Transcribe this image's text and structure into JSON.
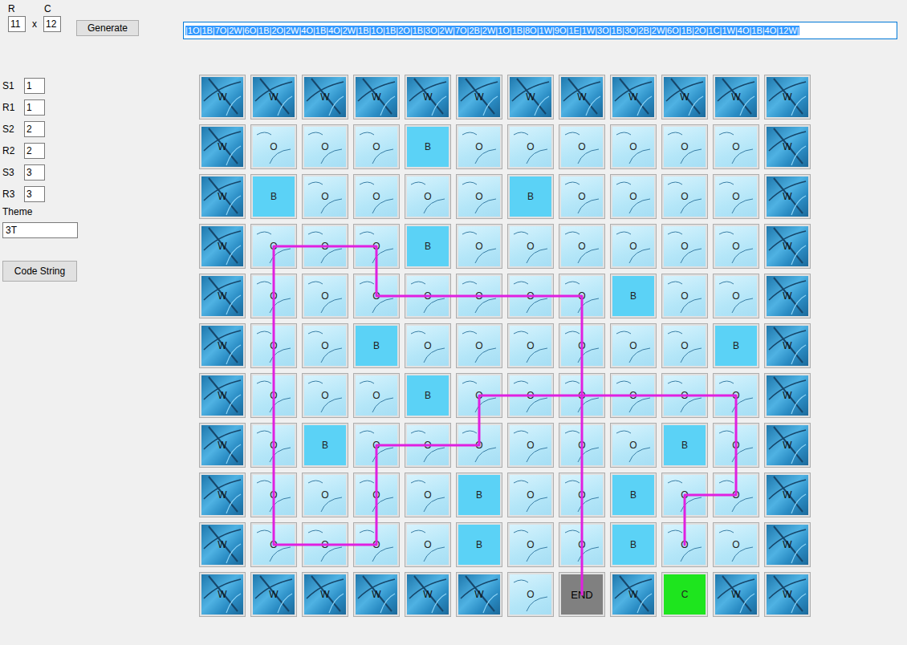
{
  "size": {
    "rows_label": "R",
    "cols_label": "C",
    "rows": "11",
    "times": "x",
    "cols": "12"
  },
  "generate_button": "Generate",
  "code_field": {
    "value": "|1O|1B|7O|2W|6O|1B|2O|2W|4O|1B|4O|2W|1B|1O|1B|2O|1B|3O|2W|7O|2B|2W|1O|1B|8O|1W|9O|1E|1W|3O|1B|3O|2B|2W|6O|1B|2O|1C|1W|4O|1B|4O|12W|",
    "selected": true
  },
  "params": [
    {
      "label": "S1",
      "value": "1"
    },
    {
      "label": "R1",
      "value": "1"
    },
    {
      "label": "S2",
      "value": "2"
    },
    {
      "label": "R2",
      "value": "2"
    },
    {
      "label": "S3",
      "value": "3"
    },
    {
      "label": "R3",
      "value": "3"
    }
  ],
  "theme": {
    "label": "Theme",
    "value": "3T"
  },
  "code_button": "Code String",
  "grid": {
    "rows": [
      [
        {
          "kind": "wall",
          "label": "W"
        },
        {
          "kind": "wall",
          "label": "W"
        },
        {
          "kind": "wall",
          "label": "W"
        },
        {
          "kind": "wall",
          "label": "W"
        },
        {
          "kind": "wall",
          "label": "W"
        },
        {
          "kind": "wall",
          "label": "W"
        },
        {
          "kind": "wall",
          "label": "W"
        },
        {
          "kind": "wall",
          "label": "W"
        },
        {
          "kind": "wall",
          "label": "W"
        },
        {
          "kind": "wall",
          "label": "W"
        },
        {
          "kind": "wall",
          "label": "W"
        },
        {
          "kind": "wall",
          "label": "W"
        }
      ],
      [
        {
          "kind": "wall",
          "label": "W"
        },
        {
          "kind": "open",
          "label": "O"
        },
        {
          "kind": "open",
          "label": "O"
        },
        {
          "kind": "open",
          "label": "O"
        },
        {
          "kind": "block",
          "label": "B"
        },
        {
          "kind": "open",
          "label": "O"
        },
        {
          "kind": "open",
          "label": "O"
        },
        {
          "kind": "open",
          "label": "O"
        },
        {
          "kind": "open",
          "label": "O"
        },
        {
          "kind": "open",
          "label": "O"
        },
        {
          "kind": "open",
          "label": "O"
        },
        {
          "kind": "wall",
          "label": "W"
        }
      ],
      [
        {
          "kind": "wall",
          "label": "W"
        },
        {
          "kind": "block",
          "label": "B"
        },
        {
          "kind": "open",
          "label": "O"
        },
        {
          "kind": "open",
          "label": "O"
        },
        {
          "kind": "open",
          "label": "O"
        },
        {
          "kind": "open",
          "label": "O"
        },
        {
          "kind": "block",
          "label": "B"
        },
        {
          "kind": "open",
          "label": "O"
        },
        {
          "kind": "open",
          "label": "O"
        },
        {
          "kind": "open",
          "label": "O"
        },
        {
          "kind": "open",
          "label": "O"
        },
        {
          "kind": "wall",
          "label": "W"
        }
      ],
      [
        {
          "kind": "wall",
          "label": "W"
        },
        {
          "kind": "open",
          "label": "O"
        },
        {
          "kind": "open",
          "label": "O"
        },
        {
          "kind": "open",
          "label": "O"
        },
        {
          "kind": "block",
          "label": "B"
        },
        {
          "kind": "open",
          "label": "O"
        },
        {
          "kind": "open",
          "label": "O"
        },
        {
          "kind": "open",
          "label": "O"
        },
        {
          "kind": "open",
          "label": "O"
        },
        {
          "kind": "open",
          "label": "O"
        },
        {
          "kind": "open",
          "label": "O"
        },
        {
          "kind": "wall",
          "label": "W"
        }
      ],
      [
        {
          "kind": "wall",
          "label": "W"
        },
        {
          "kind": "open",
          "label": "O"
        },
        {
          "kind": "open",
          "label": "O"
        },
        {
          "kind": "open",
          "label": "O"
        },
        {
          "kind": "open",
          "label": "O"
        },
        {
          "kind": "open",
          "label": "O"
        },
        {
          "kind": "open",
          "label": "O"
        },
        {
          "kind": "open",
          "label": "O"
        },
        {
          "kind": "block",
          "label": "B"
        },
        {
          "kind": "open",
          "label": "O"
        },
        {
          "kind": "open",
          "label": "O"
        },
        {
          "kind": "wall",
          "label": "W"
        }
      ],
      [
        {
          "kind": "wall",
          "label": "W"
        },
        {
          "kind": "open",
          "label": "O"
        },
        {
          "kind": "open",
          "label": "O"
        },
        {
          "kind": "block",
          "label": "B"
        },
        {
          "kind": "open",
          "label": "O"
        },
        {
          "kind": "open",
          "label": "O"
        },
        {
          "kind": "open",
          "label": "O"
        },
        {
          "kind": "open",
          "label": "O"
        },
        {
          "kind": "open",
          "label": "O"
        },
        {
          "kind": "open",
          "label": "O"
        },
        {
          "kind": "block",
          "label": "B"
        },
        {
          "kind": "wall",
          "label": "W"
        }
      ],
      [
        {
          "kind": "wall",
          "label": "W"
        },
        {
          "kind": "open",
          "label": "O"
        },
        {
          "kind": "open",
          "label": "O"
        },
        {
          "kind": "open",
          "label": "O"
        },
        {
          "kind": "block",
          "label": "B"
        },
        {
          "kind": "open",
          "label": "O"
        },
        {
          "kind": "open",
          "label": "O"
        },
        {
          "kind": "open",
          "label": "O"
        },
        {
          "kind": "open",
          "label": "O"
        },
        {
          "kind": "open",
          "label": "O"
        },
        {
          "kind": "open",
          "label": "O"
        },
        {
          "kind": "wall",
          "label": "W"
        }
      ],
      [
        {
          "kind": "wall",
          "label": "W"
        },
        {
          "kind": "open",
          "label": "O"
        },
        {
          "kind": "block",
          "label": "B"
        },
        {
          "kind": "open",
          "label": "O"
        },
        {
          "kind": "open",
          "label": "O"
        },
        {
          "kind": "open",
          "label": "O"
        },
        {
          "kind": "open",
          "label": "O"
        },
        {
          "kind": "open",
          "label": "O"
        },
        {
          "kind": "open",
          "label": "O"
        },
        {
          "kind": "block",
          "label": "B"
        },
        {
          "kind": "open",
          "label": "O"
        },
        {
          "kind": "wall",
          "label": "W"
        }
      ],
      [
        {
          "kind": "wall",
          "label": "W"
        },
        {
          "kind": "open",
          "label": "O"
        },
        {
          "kind": "open",
          "label": "O"
        },
        {
          "kind": "open",
          "label": "O"
        },
        {
          "kind": "open",
          "label": "O"
        },
        {
          "kind": "block",
          "label": "B"
        },
        {
          "kind": "open",
          "label": "O"
        },
        {
          "kind": "open",
          "label": "O"
        },
        {
          "kind": "block",
          "label": "B"
        },
        {
          "kind": "open",
          "label": "O"
        },
        {
          "kind": "open",
          "label": "O"
        },
        {
          "kind": "wall",
          "label": "W"
        }
      ],
      [
        {
          "kind": "wall",
          "label": "W"
        },
        {
          "kind": "open",
          "label": "O"
        },
        {
          "kind": "open",
          "label": "O"
        },
        {
          "kind": "open",
          "label": "O"
        },
        {
          "kind": "open",
          "label": "O"
        },
        {
          "kind": "block",
          "label": "B"
        },
        {
          "kind": "open",
          "label": "O"
        },
        {
          "kind": "open",
          "label": "O"
        },
        {
          "kind": "block",
          "label": "B"
        },
        {
          "kind": "open",
          "label": "O"
        },
        {
          "kind": "open",
          "label": "O"
        },
        {
          "kind": "wall",
          "label": "W"
        }
      ],
      [
        {
          "kind": "wall",
          "label": "W"
        },
        {
          "kind": "wall",
          "label": "W"
        },
        {
          "kind": "wall",
          "label": "W"
        },
        {
          "kind": "wall",
          "label": "W"
        },
        {
          "kind": "wall",
          "label": "W"
        },
        {
          "kind": "wall",
          "label": "W"
        },
        {
          "kind": "open",
          "label": "O"
        },
        {
          "kind": "end",
          "label": "END"
        },
        {
          "kind": "wall",
          "label": "W"
        },
        {
          "kind": "goal",
          "label": "C"
        },
        {
          "kind": "wall",
          "label": "W"
        },
        {
          "kind": "wall",
          "label": "W"
        }
      ]
    ]
  },
  "path": {
    "cells": [
      [
        9,
        9
      ],
      [
        8,
        9
      ],
      [
        8,
        10
      ],
      [
        6,
        10
      ],
      [
        6,
        5
      ],
      [
        7,
        5
      ],
      [
        7,
        3
      ],
      [
        9,
        3
      ],
      [
        9,
        1
      ],
      [
        3,
        1
      ],
      [
        3,
        3
      ],
      [
        4,
        3
      ],
      [
        4,
        7
      ],
      [
        10,
        7
      ]
    ]
  }
}
